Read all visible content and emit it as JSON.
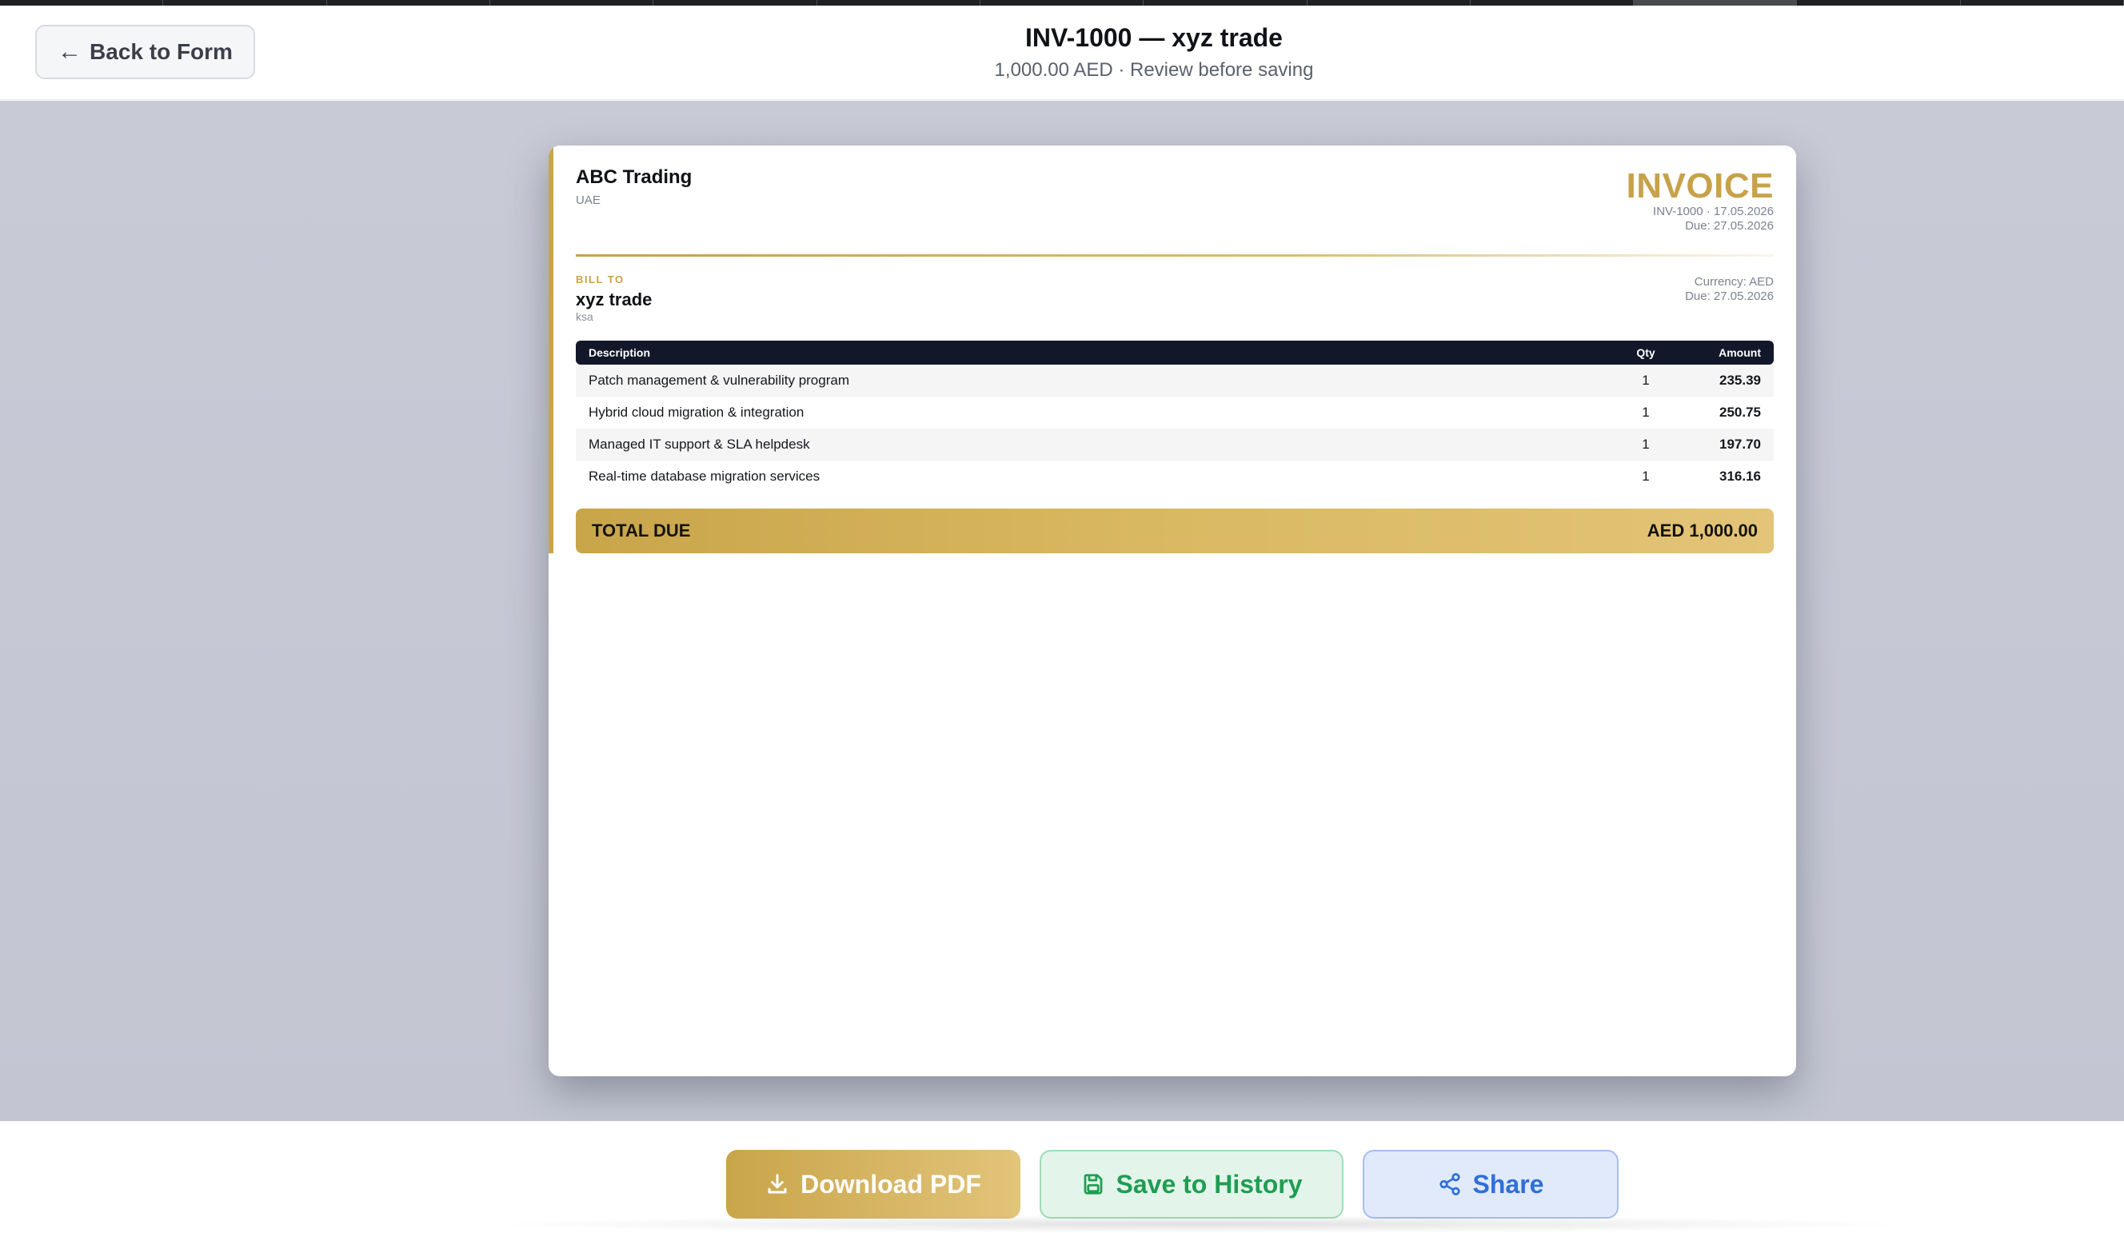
{
  "header": {
    "back_label": "Back to Form",
    "title": "INV-1000 — xyz trade",
    "subtitle": "1,000.00 AED · Review before saving"
  },
  "invoice": {
    "company": {
      "name": "ABC Trading",
      "country": "UAE"
    },
    "heading": "INVOICE",
    "meta_line1": "INV-1000 · 17.05.2026",
    "meta_line2": "Due: 27.05.2026",
    "bill_to_label": "BILL TO",
    "client": {
      "name": "xyz trade",
      "location": "ksa"
    },
    "currency_line": "Currency: AED",
    "due_line": "Due: 27.05.2026",
    "columns": {
      "description": "Description",
      "qty": "Qty",
      "amount": "Amount"
    },
    "items": [
      {
        "description": "Patch management & vulnerability program",
        "qty": "1",
        "amount": "235.39"
      },
      {
        "description": "Hybrid cloud migration & integration",
        "qty": "1",
        "amount": "250.75"
      },
      {
        "description": "Managed IT support & SLA helpdesk",
        "qty": "1",
        "amount": "197.70"
      },
      {
        "description": "Real-time database migration services",
        "qty": "1",
        "amount": "316.16"
      }
    ],
    "total_label": "TOTAL DUE",
    "total_value": "AED 1,000.00"
  },
  "actions": {
    "download_label": "Download PDF",
    "save_label": "Save to History",
    "share_label": "Share"
  },
  "icons": {
    "back": "arrow-left-icon",
    "download": "download-icon",
    "save": "save-disk-icon",
    "share": "share-icon"
  },
  "colors": {
    "accent_gold": "#c7a24a",
    "table_header": "#121829",
    "save_green": "#1f9d52",
    "share_blue": "#2f6fd6"
  }
}
